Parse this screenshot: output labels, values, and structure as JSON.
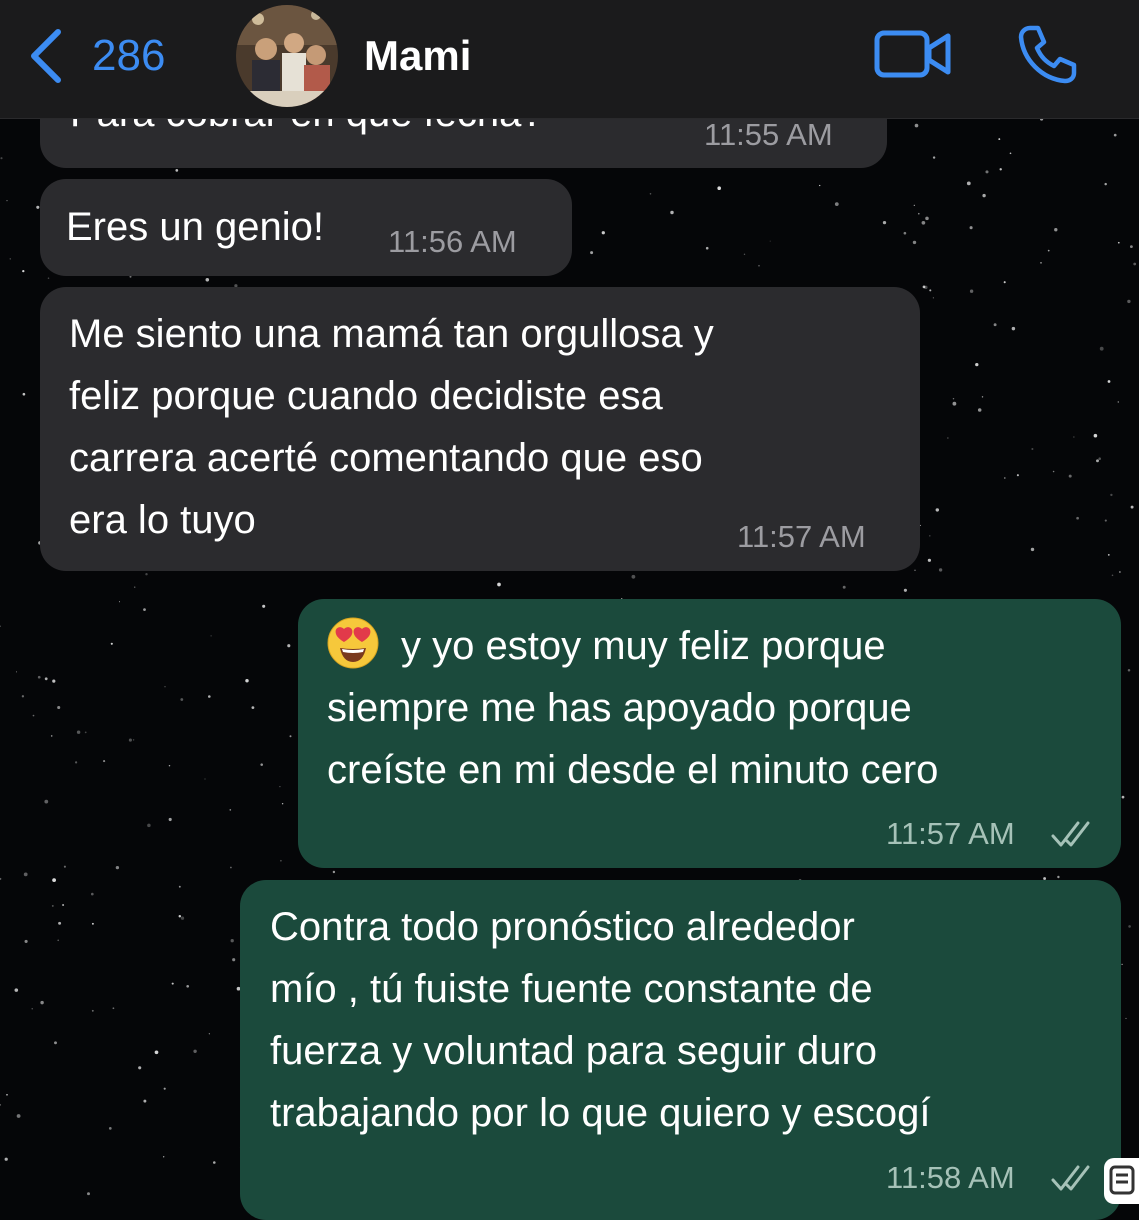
{
  "header": {
    "back_count": "286",
    "contact_name": "Mami",
    "accent_color": "#3c8cf2",
    "icons": [
      "chevron-left-icon",
      "video-call-icon",
      "phone-icon"
    ]
  },
  "messages": [
    {
      "direction": "incoming",
      "text": "Para cobrar en que fecha?",
      "time": "11:55 AM"
    },
    {
      "direction": "incoming",
      "text": "Eres un genio!",
      "time": "11:56 AM"
    },
    {
      "direction": "incoming",
      "text": "Me siento una mamá tan orgullosa y\nfeliz porque cuando decidiste esa\ncarrera acerté comentando que eso\nera lo tuyo",
      "time": "11:57 AM"
    },
    {
      "direction": "outgoing",
      "emoji": "heart-eyes-emoji",
      "text": "y yo estoy muy feliz porque\nsiempre me has apoyado porque\ncreíste en mi desde el minuto cero",
      "time": "11:57 AM",
      "status": "read"
    },
    {
      "direction": "outgoing",
      "text": "Contra todo pronóstico alrededor\nmío , tú fuiste fuente constante de\nfuerza y voluntad para seguir duro\ntrabajando por lo que quiero y escogí",
      "time": "11:58 AM",
      "status": "read"
    }
  ],
  "colors": {
    "incoming_bubble": "#2b2b2e",
    "outgoing_bubble": "#1b4a3c",
    "background": "#050608"
  }
}
